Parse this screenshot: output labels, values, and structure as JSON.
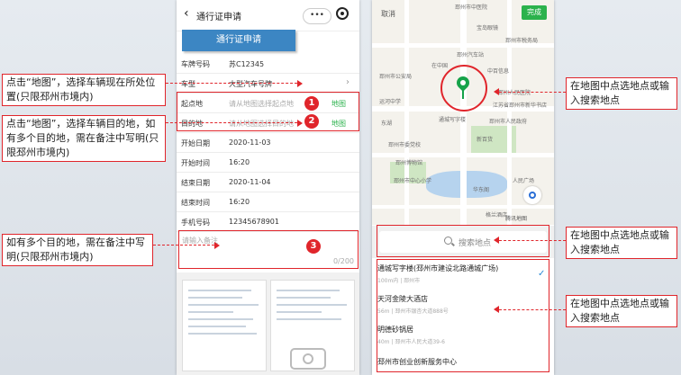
{
  "left_phone": {
    "topbar_title": "通行证申请",
    "capsule_text": "•••",
    "banner": "通行证申请",
    "form_rows": [
      {
        "label": "车牌号码",
        "value": "苏C12345"
      },
      {
        "label": "车型",
        "value": "大型汽车号牌"
      },
      {
        "label": "起点地",
        "placeholder": "请从地图选择起点地",
        "map": "地图"
      },
      {
        "label": "目的地",
        "placeholder": "请从地图选择目的地",
        "map": "地图"
      },
      {
        "label": "开始日期",
        "value": "2020-11-03"
      },
      {
        "label": "开始时间",
        "value": "16:20"
      },
      {
        "label": "结束日期",
        "value": "2020-11-04"
      },
      {
        "label": "结束时间",
        "value": "16:20"
      },
      {
        "label": "手机号码",
        "value": "12345678901"
      }
    ],
    "remark_placeholder": "请输入备注",
    "remark_count": "0/200"
  },
  "right_phone": {
    "cancel": "取消",
    "done": "完成",
    "map_labels": [
      "邳州市中医院",
      "宝岛眼镜",
      "邳州市税务局",
      "邳州汽车站",
      "在中国",
      "中百信息",
      "邳州市公安局",
      "邳州人民医院",
      "运河中学",
      "东湖",
      "邳州市人民政府",
      "江苏省邳州市新华书店",
      "通城写字楼",
      "新百货",
      "邳州市委党校",
      "邳州市中心小学",
      "华东阁",
      "人民广场",
      "邳州博物馆",
      "格兰酒店"
    ],
    "brand": "腾讯地图",
    "search_placeholder": "搜索地点",
    "results": [
      {
        "name": "通城写字楼(邳州市建设北路通城广场)",
        "addr": "100m内 | 邳州市"
      },
      {
        "name": "天河金陵大酒店",
        "addr": "56m | 邳州市银杏大道888号"
      },
      {
        "name": "明德砂锅居",
        "addr": "40m | 邳州市人民大道39-6"
      },
      {
        "name": "邳州市创业创新服务中心",
        "addr": ""
      }
    ]
  },
  "badges": [
    "1",
    "2",
    "3"
  ],
  "callouts": {
    "start": "点击“地图”，选择车辆现在所处位置(只限邳州市境内)",
    "end": "点击“地图”，选择车辆目的地，如有多个目的地，需在备注中写明(只限邳州市境内)",
    "remark": "如有多个目的地，需在备注中写明(只限邳州市境内)",
    "map_pick": "在地图中点选地点或输入搜索地点",
    "search_pick": "在地图中点选地点或输入搜索地点",
    "list_pick": "在地图中点选地点或输入搜索地点"
  }
}
